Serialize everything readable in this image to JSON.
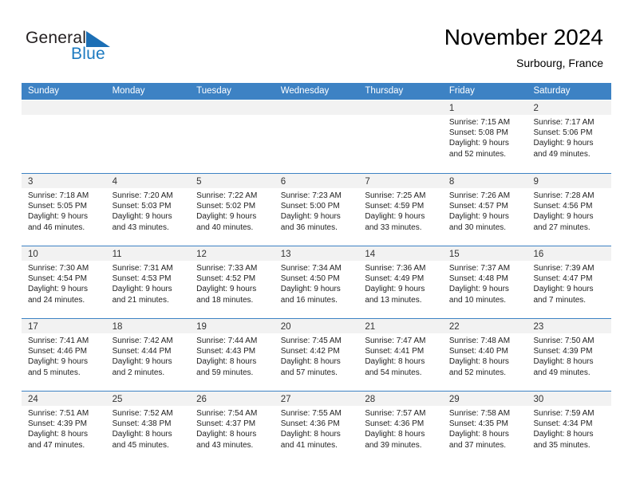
{
  "brand": {
    "name_part1": "General",
    "name_part2": "Blue",
    "flag_icon": "triangle-flag-icon",
    "blue": "#1c7ac0"
  },
  "header": {
    "title": "November 2024",
    "subtitle": "Surbourg, France"
  },
  "theme": {
    "header_blue": "#3d82c4",
    "date_band_gray": "#f2f2f2",
    "text": "#222222"
  },
  "calendar": {
    "weekdays": [
      "Sunday",
      "Monday",
      "Tuesday",
      "Wednesday",
      "Thursday",
      "Friday",
      "Saturday"
    ],
    "weeks": [
      [
        {
          "day": "",
          "lines": []
        },
        {
          "day": "",
          "lines": []
        },
        {
          "day": "",
          "lines": []
        },
        {
          "day": "",
          "lines": []
        },
        {
          "day": "",
          "lines": []
        },
        {
          "day": "1",
          "lines": [
            "Sunrise: 7:15 AM",
            "Sunset: 5:08 PM",
            "Daylight: 9 hours",
            "and 52 minutes."
          ]
        },
        {
          "day": "2",
          "lines": [
            "Sunrise: 7:17 AM",
            "Sunset: 5:06 PM",
            "Daylight: 9 hours",
            "and 49 minutes."
          ]
        }
      ],
      [
        {
          "day": "3",
          "lines": [
            "Sunrise: 7:18 AM",
            "Sunset: 5:05 PM",
            "Daylight: 9 hours",
            "and 46 minutes."
          ]
        },
        {
          "day": "4",
          "lines": [
            "Sunrise: 7:20 AM",
            "Sunset: 5:03 PM",
            "Daylight: 9 hours",
            "and 43 minutes."
          ]
        },
        {
          "day": "5",
          "lines": [
            "Sunrise: 7:22 AM",
            "Sunset: 5:02 PM",
            "Daylight: 9 hours",
            "and 40 minutes."
          ]
        },
        {
          "day": "6",
          "lines": [
            "Sunrise: 7:23 AM",
            "Sunset: 5:00 PM",
            "Daylight: 9 hours",
            "and 36 minutes."
          ]
        },
        {
          "day": "7",
          "lines": [
            "Sunrise: 7:25 AM",
            "Sunset: 4:59 PM",
            "Daylight: 9 hours",
            "and 33 minutes."
          ]
        },
        {
          "day": "8",
          "lines": [
            "Sunrise: 7:26 AM",
            "Sunset: 4:57 PM",
            "Daylight: 9 hours",
            "and 30 minutes."
          ]
        },
        {
          "day": "9",
          "lines": [
            "Sunrise: 7:28 AM",
            "Sunset: 4:56 PM",
            "Daylight: 9 hours",
            "and 27 minutes."
          ]
        }
      ],
      [
        {
          "day": "10",
          "lines": [
            "Sunrise: 7:30 AM",
            "Sunset: 4:54 PM",
            "Daylight: 9 hours",
            "and 24 minutes."
          ]
        },
        {
          "day": "11",
          "lines": [
            "Sunrise: 7:31 AM",
            "Sunset: 4:53 PM",
            "Daylight: 9 hours",
            "and 21 minutes."
          ]
        },
        {
          "day": "12",
          "lines": [
            "Sunrise: 7:33 AM",
            "Sunset: 4:52 PM",
            "Daylight: 9 hours",
            "and 18 minutes."
          ]
        },
        {
          "day": "13",
          "lines": [
            "Sunrise: 7:34 AM",
            "Sunset: 4:50 PM",
            "Daylight: 9 hours",
            "and 16 minutes."
          ]
        },
        {
          "day": "14",
          "lines": [
            "Sunrise: 7:36 AM",
            "Sunset: 4:49 PM",
            "Daylight: 9 hours",
            "and 13 minutes."
          ]
        },
        {
          "day": "15",
          "lines": [
            "Sunrise: 7:37 AM",
            "Sunset: 4:48 PM",
            "Daylight: 9 hours",
            "and 10 minutes."
          ]
        },
        {
          "day": "16",
          "lines": [
            "Sunrise: 7:39 AM",
            "Sunset: 4:47 PM",
            "Daylight: 9 hours",
            "and 7 minutes."
          ]
        }
      ],
      [
        {
          "day": "17",
          "lines": [
            "Sunrise: 7:41 AM",
            "Sunset: 4:46 PM",
            "Daylight: 9 hours",
            "and 5 minutes."
          ]
        },
        {
          "day": "18",
          "lines": [
            "Sunrise: 7:42 AM",
            "Sunset: 4:44 PM",
            "Daylight: 9 hours",
            "and 2 minutes."
          ]
        },
        {
          "day": "19",
          "lines": [
            "Sunrise: 7:44 AM",
            "Sunset: 4:43 PM",
            "Daylight: 8 hours",
            "and 59 minutes."
          ]
        },
        {
          "day": "20",
          "lines": [
            "Sunrise: 7:45 AM",
            "Sunset: 4:42 PM",
            "Daylight: 8 hours",
            "and 57 minutes."
          ]
        },
        {
          "day": "21",
          "lines": [
            "Sunrise: 7:47 AM",
            "Sunset: 4:41 PM",
            "Daylight: 8 hours",
            "and 54 minutes."
          ]
        },
        {
          "day": "22",
          "lines": [
            "Sunrise: 7:48 AM",
            "Sunset: 4:40 PM",
            "Daylight: 8 hours",
            "and 52 minutes."
          ]
        },
        {
          "day": "23",
          "lines": [
            "Sunrise: 7:50 AM",
            "Sunset: 4:39 PM",
            "Daylight: 8 hours",
            "and 49 minutes."
          ]
        }
      ],
      [
        {
          "day": "24",
          "lines": [
            "Sunrise: 7:51 AM",
            "Sunset: 4:39 PM",
            "Daylight: 8 hours",
            "and 47 minutes."
          ]
        },
        {
          "day": "25",
          "lines": [
            "Sunrise: 7:52 AM",
            "Sunset: 4:38 PM",
            "Daylight: 8 hours",
            "and 45 minutes."
          ]
        },
        {
          "day": "26",
          "lines": [
            "Sunrise: 7:54 AM",
            "Sunset: 4:37 PM",
            "Daylight: 8 hours",
            "and 43 minutes."
          ]
        },
        {
          "day": "27",
          "lines": [
            "Sunrise: 7:55 AM",
            "Sunset: 4:36 PM",
            "Daylight: 8 hours",
            "and 41 minutes."
          ]
        },
        {
          "day": "28",
          "lines": [
            "Sunrise: 7:57 AM",
            "Sunset: 4:36 PM",
            "Daylight: 8 hours",
            "and 39 minutes."
          ]
        },
        {
          "day": "29",
          "lines": [
            "Sunrise: 7:58 AM",
            "Sunset: 4:35 PM",
            "Daylight: 8 hours",
            "and 37 minutes."
          ]
        },
        {
          "day": "30",
          "lines": [
            "Sunrise: 7:59 AM",
            "Sunset: 4:34 PM",
            "Daylight: 8 hours",
            "and 35 minutes."
          ]
        }
      ]
    ]
  }
}
